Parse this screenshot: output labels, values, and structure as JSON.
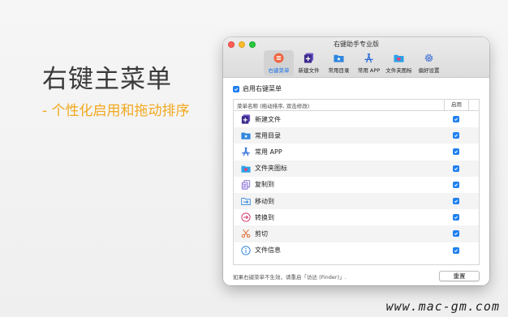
{
  "promo": {
    "headline": "右键主菜单",
    "subline": "- 个性化启用和拖动排序",
    "watermark": "www.mac-gm.com"
  },
  "window": {
    "title": "右键助手专业版"
  },
  "toolbar": {
    "items": [
      {
        "label": "右键菜单",
        "icon": "menu-list-icon",
        "active": true
      },
      {
        "label": "新建文件",
        "icon": "new-file-icon",
        "active": false
      },
      {
        "label": "常用目录",
        "icon": "folder-star-icon",
        "active": false
      },
      {
        "label": "常用 APP",
        "icon": "app-store-icon",
        "active": false
      },
      {
        "label": "文件夹图标",
        "icon": "folder-heart-icon",
        "active": false
      },
      {
        "label": "偏好设置",
        "icon": "gear-icon",
        "active": false
      }
    ]
  },
  "main": {
    "enable_label": "启用右键菜单",
    "enable_checked": true,
    "columns": {
      "name": "菜单名称 (拖动排序, 双击修改)",
      "enable": "启用"
    },
    "rows": [
      {
        "label": "新建文件",
        "icon": "new-file-icon",
        "checked": true
      },
      {
        "label": "常用目录",
        "icon": "folder-star-icon",
        "checked": true
      },
      {
        "label": "常用 APP",
        "icon": "app-store-icon",
        "checked": true
      },
      {
        "label": "文件夹图标",
        "icon": "folder-heart-icon",
        "checked": true
      },
      {
        "label": "复制到",
        "icon": "copy-to-icon",
        "checked": true
      },
      {
        "label": "移动到",
        "icon": "move-to-icon",
        "checked": true
      },
      {
        "label": "转换到",
        "icon": "convert-icon",
        "checked": true
      },
      {
        "label": "剪切",
        "icon": "scissors-icon",
        "checked": true
      },
      {
        "label": "文件信息",
        "icon": "info-icon",
        "checked": true
      }
    ],
    "footer_note": "如果右键菜单不生效，请重启「访达 (Finder)」.",
    "reset_label": "重置"
  },
  "colors": {
    "accent": "#1f7ff0",
    "promo_subline": "#f2a81d"
  }
}
